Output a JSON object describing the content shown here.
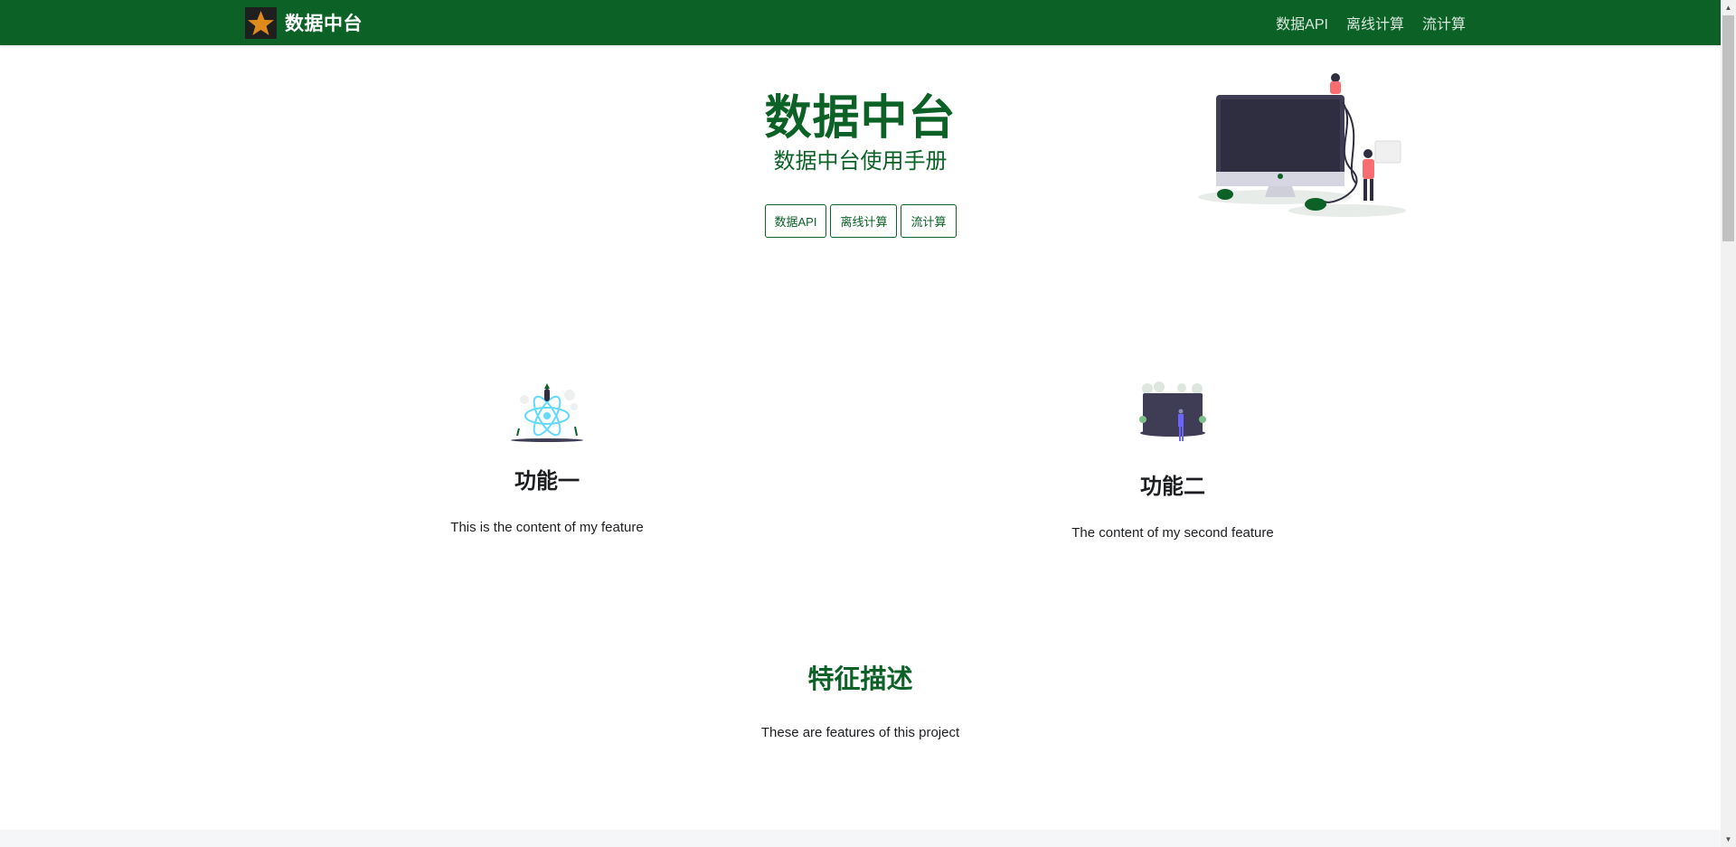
{
  "navbar": {
    "brand_title": "数据中台",
    "links": [
      "数据API",
      "离线计算",
      "流计算"
    ]
  },
  "hero": {
    "title": "数据中台",
    "subtitle": "数据中台使用手册",
    "buttons": [
      "数据API",
      "离线计算",
      "流计算"
    ]
  },
  "features": [
    {
      "title": "功能一",
      "text": "This is the content of my feature"
    },
    {
      "title": "功能二",
      "text": "The content of my second feature"
    }
  ],
  "section": {
    "title": "特征描述",
    "text": "These are features of this project"
  },
  "colors": {
    "brand": "#0b6126",
    "text": "#1c1e21"
  }
}
